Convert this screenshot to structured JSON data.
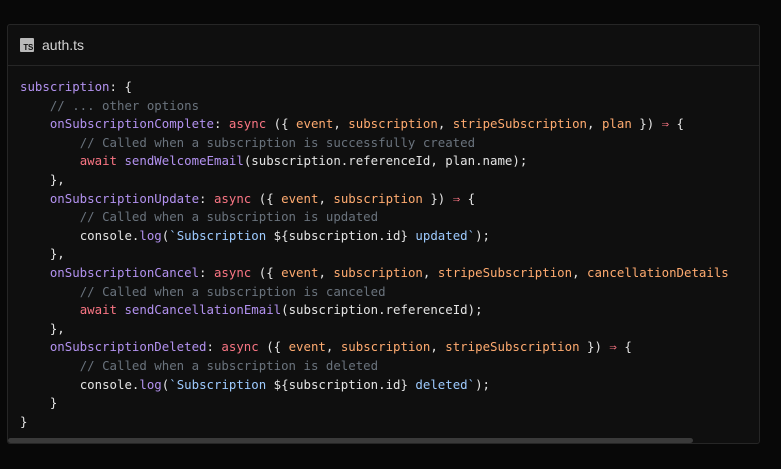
{
  "tab": {
    "filename": "auth.ts",
    "icon": "typescript-file-icon",
    "icon_text": "TS"
  },
  "code": {
    "l1": {
      "a": "subscription",
      "b": ": {"
    },
    "l2": {
      "indent": "    ",
      "comment": "// ... other options"
    },
    "l3": {
      "indent": "    ",
      "name": "onSubscriptionComplete",
      "colon": ": ",
      "kw": "async",
      "open": " ({ ",
      "p1": "event",
      "sep1": ", ",
      "p2": "subscription",
      "sep2": ", ",
      "p3": "stripeSubscription",
      "sep3": ", ",
      "p4": "plan",
      "close": " }) ",
      "arrow": "⇒",
      "brace": " {"
    },
    "l4": {
      "indent": "        ",
      "comment": "// Called when a subscription is successfully created"
    },
    "l5": {
      "indent": "        ",
      "kw": "await",
      "sp": " ",
      "fn": "sendWelcomeEmail",
      "rest": "(subscription.referenceId, plan.name);"
    },
    "l6": {
      "text": "    },"
    },
    "l7": {
      "indent": "    ",
      "name": "onSubscriptionUpdate",
      "colon": ": ",
      "kw": "async",
      "open": " ({ ",
      "p1": "event",
      "sep1": ", ",
      "p2": "subscription",
      "close": " }) ",
      "arrow": "⇒",
      "brace": " {"
    },
    "l8": {
      "indent": "        ",
      "comment": "// Called when a subscription is updated"
    },
    "l9": {
      "indent": "        ",
      "obj": "console.",
      "fn": "log",
      "open": "(",
      "str1": "`Subscription ",
      "interp": "${subscription.id}",
      "str2": " updated`",
      "end": ");"
    },
    "l10": {
      "text": "    },"
    },
    "l11": {
      "indent": "    ",
      "name": "onSubscriptionCancel",
      "colon": ": ",
      "kw": "async",
      "open": " ({ ",
      "p1": "event",
      "sep1": ", ",
      "p2": "subscription",
      "sep2": ", ",
      "p3": "stripeSubscription",
      "sep3": ", ",
      "p4": "cancellationDetails"
    },
    "l12": {
      "indent": "        ",
      "comment": "// Called when a subscription is canceled"
    },
    "l13": {
      "indent": "        ",
      "kw": "await",
      "sp": " ",
      "fn": "sendCancellationEmail",
      "rest": "(subscription.referenceId);"
    },
    "l14": {
      "text": "    },"
    },
    "l15": {
      "indent": "    ",
      "name": "onSubscriptionDeleted",
      "colon": ": ",
      "kw": "async",
      "open": " ({ ",
      "p1": "event",
      "sep1": ", ",
      "p2": "subscription",
      "sep2": ", ",
      "p3": "stripeSubscription",
      "close": " }) ",
      "arrow": "⇒",
      "brace": " {"
    },
    "l16": {
      "indent": "        ",
      "comment": "// Called when a subscription is deleted"
    },
    "l17": {
      "indent": "        ",
      "obj": "console.",
      "fn": "log",
      "open": "(",
      "str1": "`Subscription ",
      "interp": "${subscription.id}",
      "str2": " deleted`",
      "end": ");"
    },
    "l18": {
      "text": "    }"
    },
    "l19": {
      "text": "}"
    }
  },
  "colors": {
    "keyword": "#f97583",
    "function": "#b392f0",
    "parameter": "#ffab70",
    "comment": "#6a737d",
    "string": "#9ecbff",
    "text": "#e4e4e4",
    "background": "#0f0f0f"
  }
}
